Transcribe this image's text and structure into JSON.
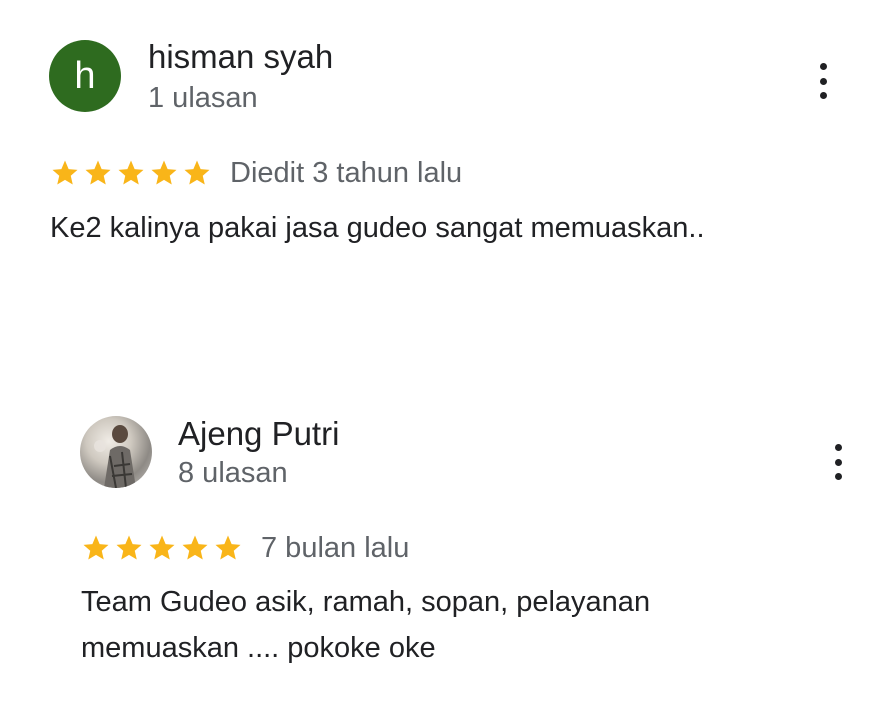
{
  "reviews": [
    {
      "avatar_letter": "h",
      "avatar_color": "#2e6b1f",
      "name": "hisman syah",
      "review_count": "1 ulasan",
      "rating": 5,
      "date": "Diedit 3 tahun lalu",
      "text_lines": [
        "Ke2 kalinya pakai jasa gudeo sangat memuaskan.."
      ],
      "menu_icon": "more-vert-icon"
    },
    {
      "avatar_letter": "",
      "name": "Ajeng Putri",
      "review_count": "8 ulasan",
      "rating": 5,
      "date": "7 bulan lalu",
      "text_lines": [
        "Team Gudeo asik, ramah, sopan, pelayanan",
        "memuaskan .... pokoke oke"
      ],
      "menu_icon": "more-vert-icon"
    }
  ],
  "colors": {
    "star": "#f9b519",
    "secondary_text": "#5f6368",
    "primary_text": "#202124"
  }
}
